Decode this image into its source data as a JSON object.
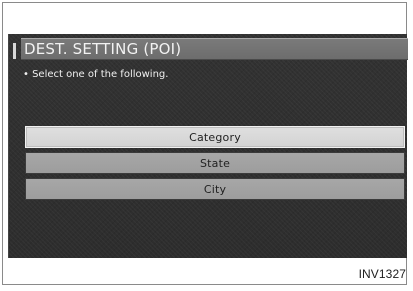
{
  "screen": {
    "title": "DEST. SETTING (POI)",
    "instruction": "• Select one of the following.",
    "options": [
      {
        "label": "Category",
        "selected": true
      },
      {
        "label": "State",
        "selected": false
      },
      {
        "label": "City",
        "selected": false
      }
    ]
  },
  "footer": {
    "code": "INV1327"
  }
}
